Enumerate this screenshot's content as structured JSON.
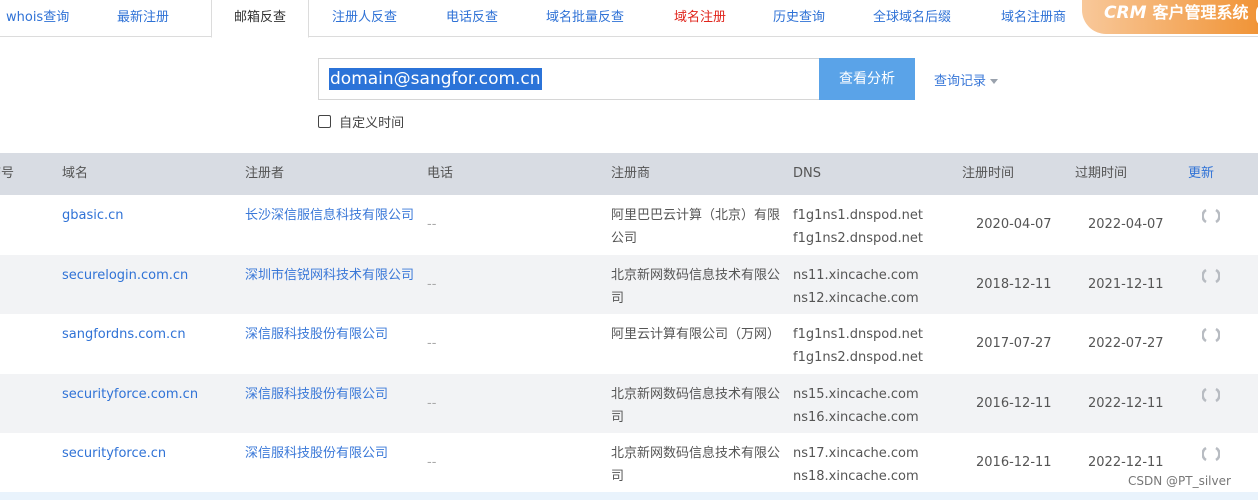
{
  "tabs": [
    {
      "label": "whois查询",
      "style": "normal"
    },
    {
      "label": "最新注册",
      "style": "normal"
    },
    {
      "label": "邮箱反查",
      "style": "active"
    },
    {
      "label": "注册人反查",
      "style": "normal"
    },
    {
      "label": "电话反查",
      "style": "normal"
    },
    {
      "label": "域名批量反查",
      "style": "normal"
    },
    {
      "label": "域名注册",
      "style": "red"
    },
    {
      "label": "历史查询",
      "style": "normal"
    },
    {
      "label": "全球域名后缀",
      "style": "normal"
    },
    {
      "label": "域名注册商",
      "style": "normal"
    }
  ],
  "crm_banner": {
    "logo": "CRM",
    "text": "客户管理系统"
  },
  "search": {
    "value": "domain@sangfor.com.cn",
    "button_label": "查看分析",
    "history_label": "查询记录"
  },
  "custom_time": {
    "label": "自定义时间",
    "checked": false
  },
  "table": {
    "headers": {
      "index": "序号",
      "domain": "域名",
      "registrant": "注册者",
      "phone": "电话",
      "registrar": "注册商",
      "dns": "DNS",
      "reg_date": "注册时间",
      "exp_date": "过期时间",
      "refresh": "更新"
    },
    "rows": [
      {
        "domain": "gbasic.cn",
        "registrant": "长沙深信服信息科技有限公司",
        "phone": "--",
        "registrar": "阿里巴巴云计算（北京）有限公司",
        "dns1": "f1g1ns1.dnspod.net",
        "dns2": "f1g1ns2.dnspod.net",
        "reg_date": "2020-04-07",
        "exp_date": "2022-04-07"
      },
      {
        "domain": "securelogin.com.cn",
        "registrant": "深圳市信锐网科技术有限公司",
        "phone": "--",
        "registrar": "北京新网数码信息技术有限公司",
        "dns1": "ns11.xincache.com",
        "dns2": "ns12.xincache.com",
        "reg_date": "2018-12-11",
        "exp_date": "2021-12-11"
      },
      {
        "domain": "sangfordns.com.cn",
        "registrant": "深信服科技股份有限公司",
        "phone": "--",
        "registrar": "阿里云计算有限公司（万网）",
        "dns1": "f1g1ns1.dnspod.net",
        "dns2": "f1g1ns2.dnspod.net",
        "reg_date": "2017-07-27",
        "exp_date": "2022-07-27"
      },
      {
        "domain": "securityforce.com.cn",
        "registrant": "深信服科技股份有限公司",
        "phone": "--",
        "registrar": "北京新网数码信息技术有限公司",
        "dns1": "ns15.xincache.com",
        "dns2": "ns16.xincache.com",
        "reg_date": "2016-12-11",
        "exp_date": "2022-12-11"
      },
      {
        "domain": "securityforce.cn",
        "registrant": "深信服科技股份有限公司",
        "phone": "--",
        "registrar": "北京新网数码信息技术有限公司",
        "dns1": "ns17.xincache.com",
        "dns2": "ns18.xincache.com",
        "reg_date": "2016-12-11",
        "exp_date": "2022-12-11"
      }
    ]
  },
  "watermark": "CSDN @PT_silver",
  "colors": {
    "link_blue": "#2f72d6",
    "red_tab": "#e0251c",
    "button_blue": "#5aa3e8",
    "header_gray": "#d8dce3",
    "crm_orange": "#f0902f"
  }
}
